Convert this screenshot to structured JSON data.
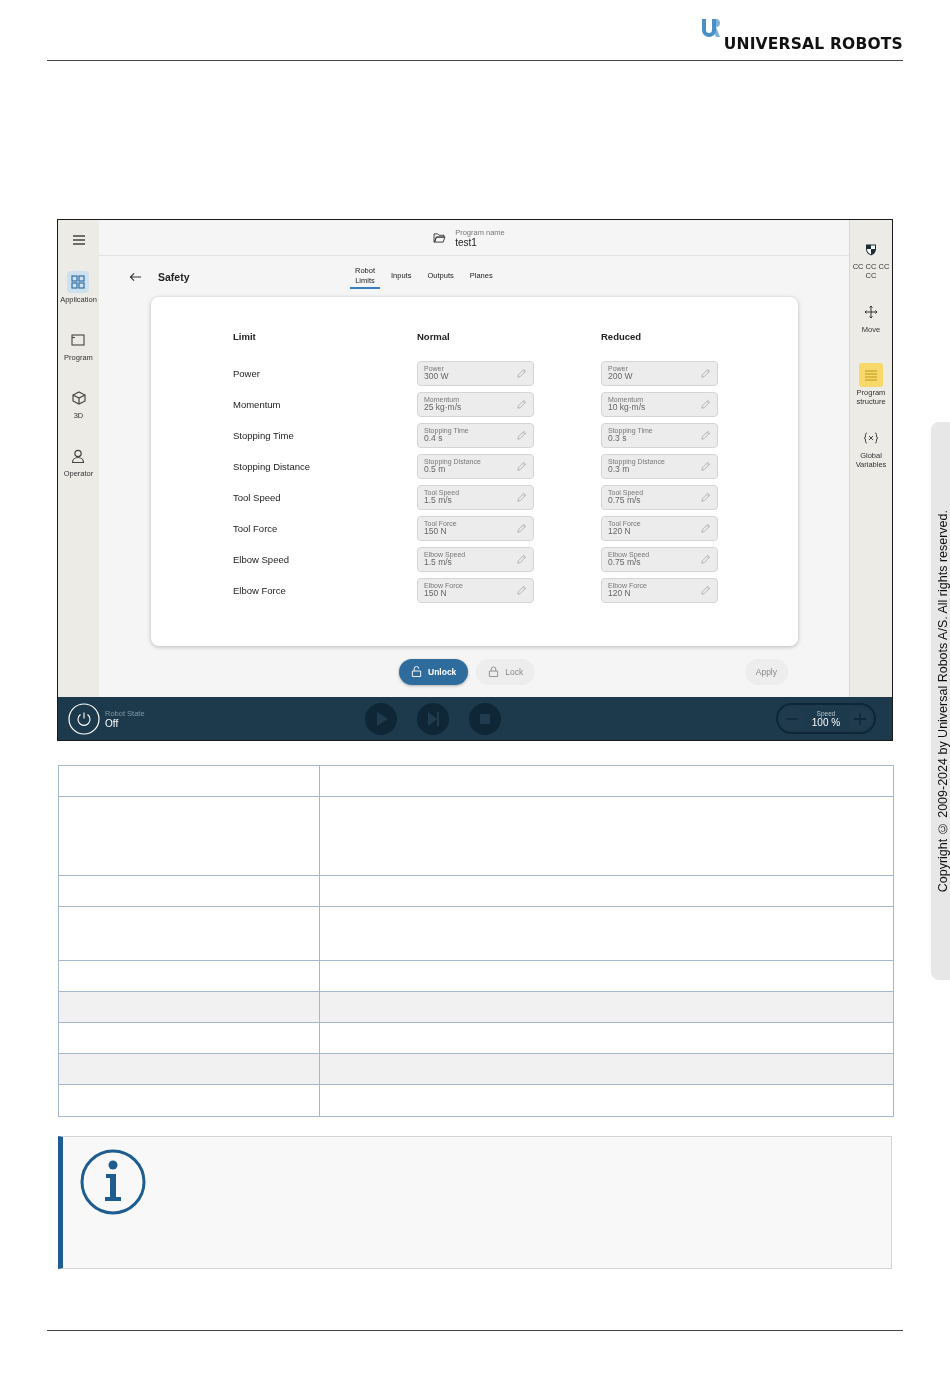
{
  "header": {
    "logo_text": "UNIVERSAL ROBOTS"
  },
  "app": {
    "left_nav": [
      {
        "kind": "apps",
        "label": "Application",
        "selected": true
      },
      {
        "kind": "program",
        "label": "Program",
        "selected": false
      },
      {
        "kind": "cube",
        "label": "3D",
        "selected": false
      },
      {
        "kind": "person",
        "label": "Operator",
        "selected": false
      }
    ],
    "program": {
      "caption": "Program name",
      "name": "test1"
    },
    "page_title": "Safety",
    "tabs": [
      {
        "label": "Robot Limits",
        "selected": true
      },
      {
        "label": "Inputs",
        "selected": false
      },
      {
        "label": "Outputs",
        "selected": false
      },
      {
        "label": "Planes",
        "selected": false
      }
    ],
    "columns": [
      "Limit",
      "Normal",
      "Reduced"
    ],
    "limits": [
      {
        "name": "Power",
        "normal": {
          "label": "Power",
          "value": "300 W",
          "disabled": true
        },
        "reduced": {
          "label": "Power",
          "value": "200 W",
          "disabled": true
        }
      },
      {
        "name": "Momentum",
        "normal": {
          "label": "Momentum",
          "value": "25 kg·m/s",
          "disabled": true
        },
        "reduced": {
          "label": "Momentum",
          "value": "10 kg·m/s",
          "disabled": true
        }
      },
      {
        "name": "Stopping Time",
        "normal": {
          "label": "Stopping Time",
          "value": "0.4 s",
          "disabled": true
        },
        "reduced": {
          "label": "Stopping Time",
          "value": "0.3 s",
          "disabled": true
        }
      },
      {
        "name": "Stopping Distance",
        "normal": {
          "label": "Stopping Distance",
          "value": "0.5 m",
          "disabled": true
        },
        "reduced": {
          "label": "Stopping Distance",
          "value": "0.3 m",
          "disabled": true
        }
      },
      {
        "name": "Tool Speed",
        "normal": {
          "label": "Tool Speed",
          "value": "1.5 m/s",
          "disabled": true
        },
        "reduced": {
          "label": "Tool Speed",
          "value": "0.75 m/s",
          "disabled": true
        }
      },
      {
        "name": "Tool Force",
        "normal": {
          "label": "Tool Force",
          "value": "150 N",
          "disabled": true
        },
        "reduced": {
          "label": "Tool Force",
          "value": "120 N",
          "disabled": true
        }
      },
      {
        "name": "Elbow Speed",
        "normal": {
          "label": "Elbow Speed",
          "value": "1.5 m/s",
          "disabled": true
        },
        "reduced": {
          "label": "Elbow Speed",
          "value": "0.75 m/s",
          "disabled": true
        }
      },
      {
        "name": "Elbow Force",
        "normal": {
          "label": "Elbow Force",
          "value": "150 N",
          "disabled": true
        },
        "reduced": {
          "label": "Elbow Force",
          "value": "120 N",
          "disabled": true
        }
      }
    ],
    "buttons": [
      {
        "kind": "unlock",
        "label": "Unlock",
        "disabled": false
      },
      {
        "kind": "lock",
        "label": "Lock",
        "disabled": true
      },
      {
        "kind": "apply",
        "label": "Apply",
        "disabled": true
      }
    ],
    "right_nav": [
      {
        "kind": "shield",
        "label": "CC CC CC CC",
        "selected": false
      },
      {
        "kind": "move",
        "label": "Move",
        "selected": false
      },
      {
        "kind": "structure",
        "label": "Program structure",
        "selected": true
      },
      {
        "kind": "variables",
        "label": "Global Variables",
        "selected": false
      }
    ],
    "robot_state": {
      "caption": "Robot State",
      "value": "Off"
    },
    "speed": {
      "caption": "Speed",
      "value": "100 %"
    }
  },
  "copyright": "Copyright © 2009-2024 by Universal Robots A/S. All rights reserved."
}
